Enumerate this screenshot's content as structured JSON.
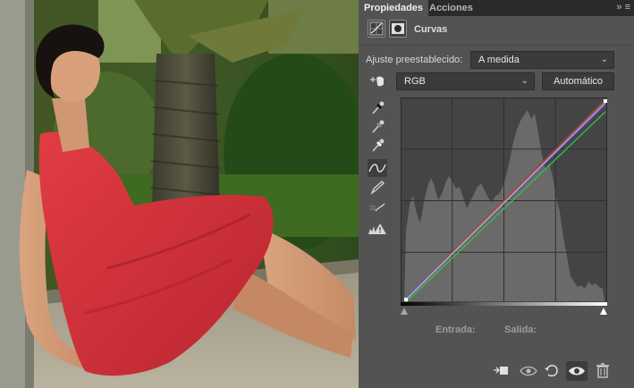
{
  "panel": {
    "tabs": [
      {
        "label": "Propiedades",
        "active": true
      },
      {
        "label": "Acciones",
        "active": false
      }
    ],
    "tab_menu_glyph": "» ≡",
    "header": {
      "title": "Curvas",
      "icons": [
        "curves-adjustment-icon",
        "layer-mask-icon"
      ]
    },
    "preset": {
      "label": "Ajuste preestablecido:",
      "value": "A medida"
    },
    "channel": {
      "value": "RGB"
    },
    "auto_button": "Automático",
    "tools": [
      "target-adjust-icon",
      "sample-black-eyedropper-icon",
      "sample-gray-eyedropper-icon",
      "sample-white-eyedropper-icon",
      "curve-points-icon",
      "pencil-draw-icon",
      "smooth-curve-icon",
      "clipping-warning-icon"
    ],
    "input_label": "Entrada:",
    "output_label": "Salida:",
    "bottom_icons": [
      "clip-to-layer-icon",
      "view-previous-state-icon",
      "reset-icon",
      "visibility-eye-icon",
      "trash-icon"
    ],
    "curves": {
      "rgb_color": "#c8c8c8",
      "red_color": "#d8413f",
      "green_color": "#3dbb4b",
      "blue_color": "#4c55ff",
      "grid_divisions": 4
    }
  }
}
